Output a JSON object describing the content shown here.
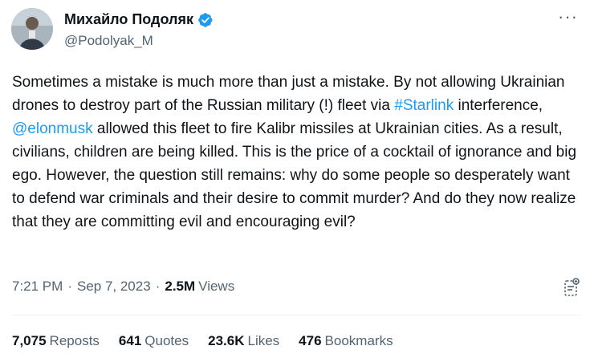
{
  "author": {
    "display_name": "Михайло Подоляк",
    "handle": "@Podolyak_M",
    "verified": true,
    "verified_color": "#1d9bf0",
    "avatar_icon": "avatar-photo"
  },
  "more_icon": "more-horizontal-icon",
  "text": {
    "part1": "Sometimes a mistake is much more than just a mistake. By not allowing Ukrainian drones to destroy part of the Russian military (!) fleet via ",
    "hashtag": "#Starlink",
    "part2": " interference, ",
    "mention": "@elonmusk",
    "part3": " allowed this fleet to fire Kalibr missiles at Ukrainian cities. As a result, civilians, children are being killed. This is the price of a cocktail of ignorance and big ego. However, the question still remains: why do some people so desperately want to defend war criminals and their desire to commit murder? And do they now realize that they are committing evil and encouraging evil?"
  },
  "meta": {
    "time": "7:21 PM",
    "separator": "·",
    "date": "Sep 7, 2023",
    "views_count": "2.5M",
    "views_label": "Views"
  },
  "stats": {
    "reposts_count": "7,075",
    "reposts_label": "Reposts",
    "quotes_count": "641",
    "quotes_label": "Quotes",
    "likes_count": "23.6K",
    "likes_label": "Likes",
    "bookmarks_count": "476",
    "bookmarks_label": "Bookmarks"
  },
  "colors": {
    "link": "#1d9bf0",
    "secondary_text": "#536471",
    "primary_text": "#0f1419"
  }
}
